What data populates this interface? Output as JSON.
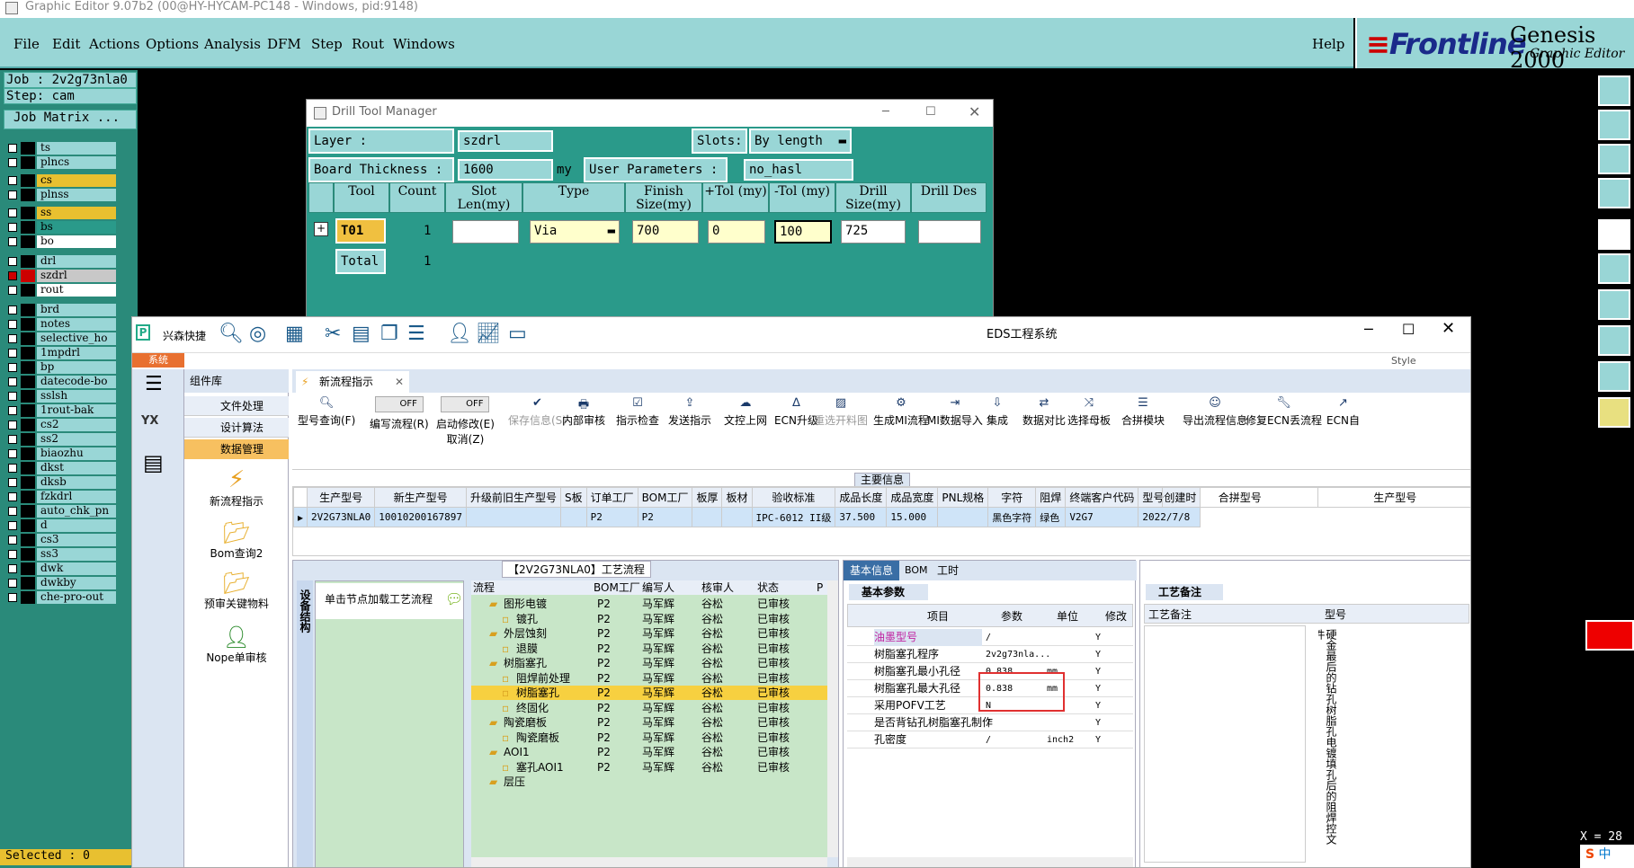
{
  "title_bar": "Graphic Editor 9.07b2 (00@HY-HYCAM-PC148 - Windows, pid:9148)",
  "menu": [
    "File",
    "Edit",
    "Actions",
    "Options",
    "Analysis",
    "DFM",
    "Step",
    "Rout",
    "Windows"
  ],
  "help": "Help",
  "logo": {
    "brand": "Frontline",
    "product": "Genesis 2000",
    "sub": "Graphic Editor"
  },
  "job": {
    "job": "Job : 2v2g73nla0",
    "step": "Step: cam",
    "matrix": "Job Matrix ..."
  },
  "layers": [
    "ts",
    "plncs",
    "cs",
    "plnss",
    "ss",
    "bs",
    "bo",
    "drl",
    "szdrl",
    "rout",
    "brd",
    "notes",
    "selective_ho",
    "1mpdrl",
    "bp",
    "datecode-bo",
    "sslsh",
    "1rout-bak",
    "cs2",
    "ss2",
    "biaozhu",
    "dkst",
    "dksb",
    "fzkdrl",
    "auto_chk_pn",
    "d",
    "cs3",
    "ss3",
    "dwk",
    "dwkby",
    "che-pro-out"
  ],
  "selected": "Selected : 0",
  "drill": {
    "title": "Drill Tool Manager",
    "layer_label": "Layer          :",
    "layer": "szdrl",
    "slots_label": "Slots:",
    "slots": "By length",
    "thick_label": "Board Thickness :",
    "thick": "1600",
    "unit": "my",
    "userparam_label": "User Parameters :",
    "userparam": "no_hasl",
    "headers": [
      "Tool",
      "Count",
      "Slot Len(my)",
      "Type",
      "Finish Size(my)",
      "+Tol (my)",
      "-Tol (my)",
      "Drill Size(my)",
      "Drill Des"
    ],
    "row": {
      "tool": "T01",
      "count": "1",
      "type": "Via",
      "finish": "700",
      "ptol": "0",
      "mtol": "100",
      "drill": "725"
    },
    "total": "Total",
    "total_count": "1"
  },
  "eds": {
    "title": "EDS工程系统",
    "brand": "兴森快捷",
    "tab_system": "系统",
    "style": "Style",
    "panel_title": "组件库",
    "nav": [
      "文件处理",
      "设计算法",
      "数据管理"
    ],
    "components": [
      "新流程指示",
      "Bom查询2",
      "预审关键物料",
      "Nope单审核"
    ],
    "doc_tab": "新流程指示",
    "toolbar": [
      {
        "label": "型号查询(F)"
      },
      {
        "label": "编写流程(R)"
      },
      {
        "label": "启动修改(E)",
        "sub": "取消(Z)"
      },
      {
        "label": "保存信息(S)"
      },
      {
        "label": "内部审核"
      },
      {
        "label": "指示检查"
      },
      {
        "label": "发送指示"
      },
      {
        "label": "文控上网"
      },
      {
        "label": "ECN升级"
      },
      {
        "label": "重选开料图"
      },
      {
        "label": "生成MI流程"
      },
      {
        "label": "MI数据导入"
      },
      {
        "label": "集成"
      },
      {
        "label": "数据对比"
      },
      {
        "label": "选择母板"
      },
      {
        "label": "合拼模块"
      },
      {
        "label": "导出流程信息"
      },
      {
        "label": "修复ECN丢流程"
      },
      {
        "label": "ECN自"
      }
    ],
    "off": "OFF",
    "main_info": "主要信息",
    "main_headers": [
      "生产型号",
      "新生产型号",
      "升级前旧生产型号",
      "S板",
      "订单工厂",
      "BOM工厂",
      "板厚",
      "板材",
      "验收标准",
      "成品长度",
      "成品宽度",
      "PNL规格",
      "字符",
      "阻焊",
      "终端客户代码",
      "型号创建时"
    ],
    "main_row": [
      "2V2G73NLA0",
      "10010200167897",
      "",
      "",
      "P2",
      "P2",
      "",
      "",
      "IPC-6012 II级",
      "37.500",
      "15.000",
      "",
      "黑色字符",
      "绿色",
      "V2G7",
      "2022/7/8"
    ],
    "merge_headers": [
      "合拼型号",
      "生产型号"
    ],
    "flow_title": "【2V2G73NLA0】工艺流程",
    "flow_side": "设备结构",
    "flow_hint": "单击节点加载工艺流程",
    "flow_headers": [
      "流程",
      "BOM工厂",
      "编写人",
      "核审人",
      "状态",
      "P"
    ],
    "flow_rows": [
      {
        "name": "图形电镀",
        "f": "P2",
        "w": "马军辉",
        "r": "谷松",
        "s": "已审核",
        "lvl": 0
      },
      {
        "name": "镀孔",
        "f": "P2",
        "w": "马军辉",
        "r": "谷松",
        "s": "已审核",
        "lvl": 1
      },
      {
        "name": "外层蚀刻",
        "f": "P2",
        "w": "马军辉",
        "r": "谷松",
        "s": "已审核",
        "lvl": 0
      },
      {
        "name": "退膜",
        "f": "P2",
        "w": "马军辉",
        "r": "谷松",
        "s": "已审核",
        "lvl": 1
      },
      {
        "name": "树脂塞孔",
        "f": "P2",
        "w": "马军辉",
        "r": "谷松",
        "s": "已审核",
        "lvl": 0
      },
      {
        "name": "阻焊前处理",
        "f": "P2",
        "w": "马军辉",
        "r": "谷松",
        "s": "已审核",
        "lvl": 1
      },
      {
        "name": "树脂塞孔",
        "f": "P2",
        "w": "马军辉",
        "r": "谷松",
        "s": "已审核",
        "lvl": 1,
        "sel": true
      },
      {
        "name": "终固化",
        "f": "P2",
        "w": "马军辉",
        "r": "谷松",
        "s": "已审核",
        "lvl": 1
      },
      {
        "name": "陶瓷磨板",
        "f": "P2",
        "w": "马军辉",
        "r": "谷松",
        "s": "已审核",
        "lvl": 0
      },
      {
        "name": "陶瓷磨板",
        "f": "P2",
        "w": "马军辉",
        "r": "谷松",
        "s": "已审核",
        "lvl": 1
      },
      {
        "name": "AOI1",
        "f": "P2",
        "w": "马军辉",
        "r": "谷松",
        "s": "已审核",
        "lvl": 0
      },
      {
        "name": "塞孔AOI1",
        "f": "P2",
        "w": "马军辉",
        "r": "谷松",
        "s": "已审核",
        "lvl": 1
      },
      {
        "name": "层压",
        "f": "",
        "w": "",
        "r": "",
        "s": "",
        "lvl": 0
      }
    ],
    "basic_tabs": [
      "基本信息",
      "BOM",
      "工时"
    ],
    "basic_param": "基本参数",
    "param_headers": [
      "项目",
      "参数",
      "单位",
      "修改"
    ],
    "params": [
      {
        "k": "油墨型号",
        "v": "/",
        "u": "",
        "m": "Y",
        "hl": true
      },
      {
        "k": "树脂塞孔程序",
        "v": "2v2g73nla...",
        "u": "",
        "m": "Y"
      },
      {
        "k": "树脂塞孔最小孔径",
        "v": "0.838",
        "u": "mm",
        "m": "Y"
      },
      {
        "k": "树脂塞孔最大孔径",
        "v": "0.838",
        "u": "mm",
        "m": "Y"
      },
      {
        "k": "采用POFV工艺",
        "v": "N",
        "u": "",
        "m": "Y"
      },
      {
        "k": "是否背钻孔树脂塞孔制作",
        "v": "/",
        "u": "",
        "m": "Y"
      },
      {
        "k": "孔密度",
        "v": "/",
        "u": "inch2",
        "m": "Y"
      }
    ],
    "remark_tab": "工艺备注",
    "remark_header": "工艺备注",
    "type_header": "型号",
    "remark_text": "硬金最后的钻孔树脂孔电镀填孔后的阻焊控文件"
  },
  "status": {
    "ime": "中",
    "coord": "X = 28"
  }
}
